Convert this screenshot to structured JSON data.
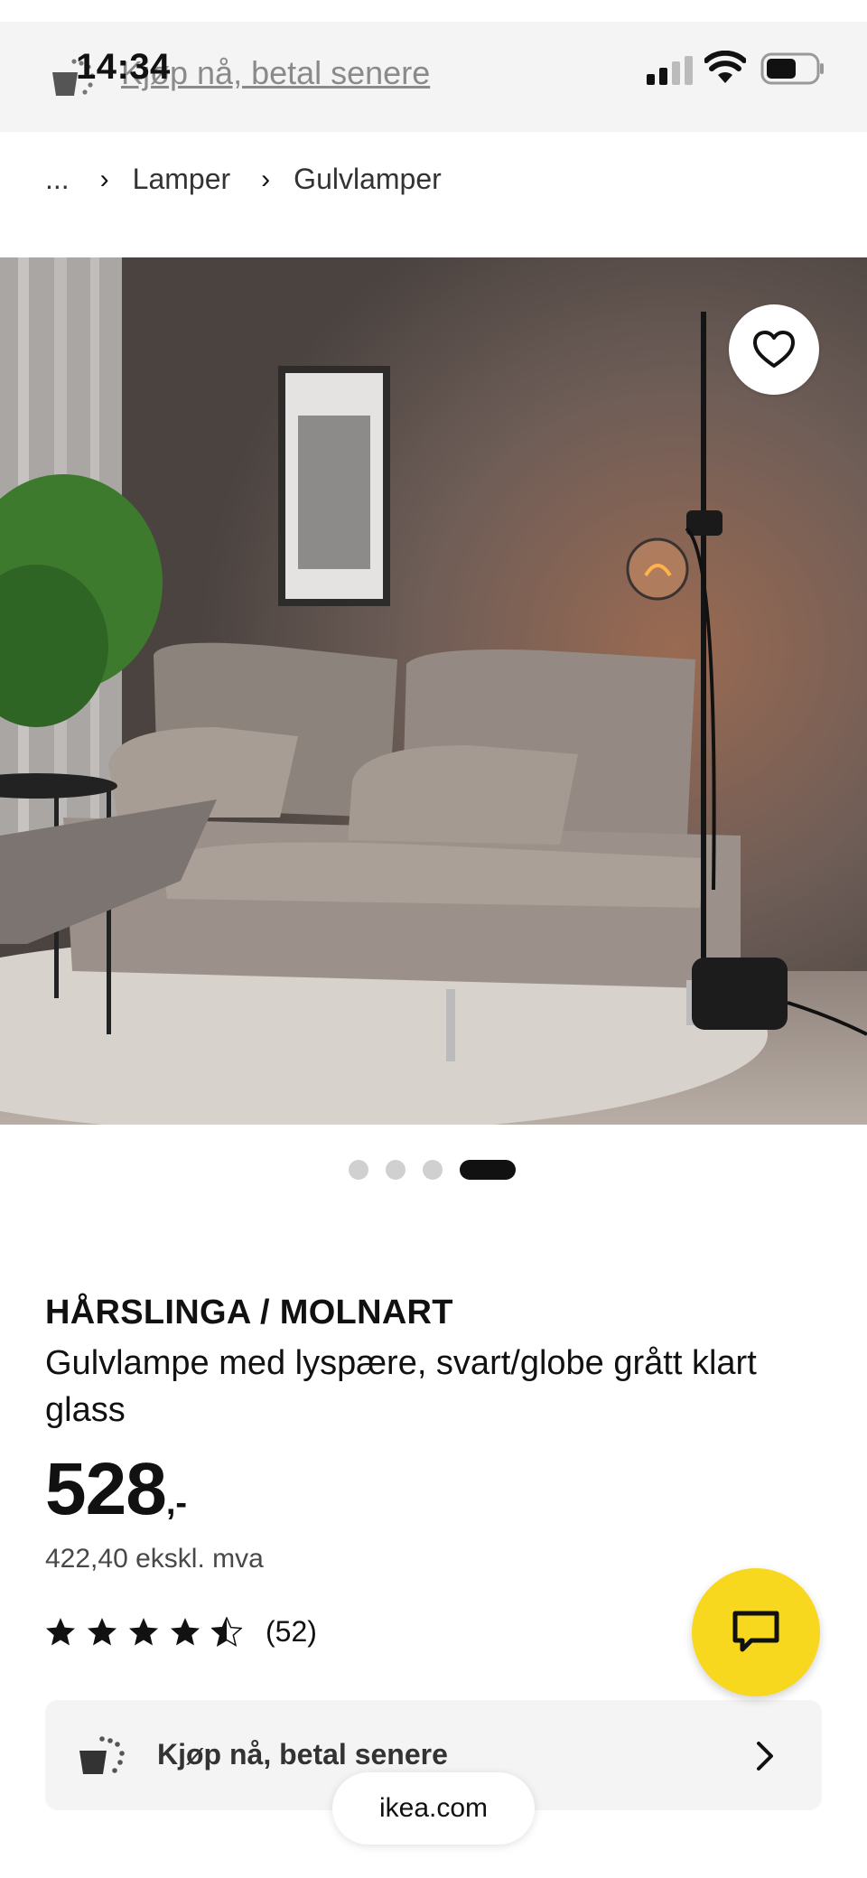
{
  "status_bar": {
    "time": "14:34"
  },
  "banner": {
    "pay_later_link": "Kjøp nå, betal senere"
  },
  "breadcrumb": {
    "items": [
      "...",
      "Lamper",
      "Gulvlamper"
    ]
  },
  "gallery": {
    "image_count": 4,
    "active_index": 3,
    "favourite_icon": "heart-outline-icon"
  },
  "product": {
    "name": "HÅRSLINGA / MOLNART",
    "description": "Gulvlampe med lyspære, svart/globe grått klart glass",
    "price": "528",
    "price_suffix": ",-",
    "price_ex_vat": "422,40 ekskl. mva",
    "rating": 4.5,
    "rating_count": "(52)"
  },
  "paylater_card": {
    "label": "Kjøp nå, betal senere",
    "icon": "payment-cart-icon",
    "chevron": "chevron-right-icon"
  },
  "chat": {
    "icon": "chat-bubble-icon",
    "color": "#F8D81E"
  },
  "browser": {
    "url": "ikea.com"
  },
  "colors": {
    "accent_yellow": "#F8D81E",
    "text_dark": "#111111",
    "text_muted": "#484848",
    "card_bg": "#F4F4F4"
  }
}
